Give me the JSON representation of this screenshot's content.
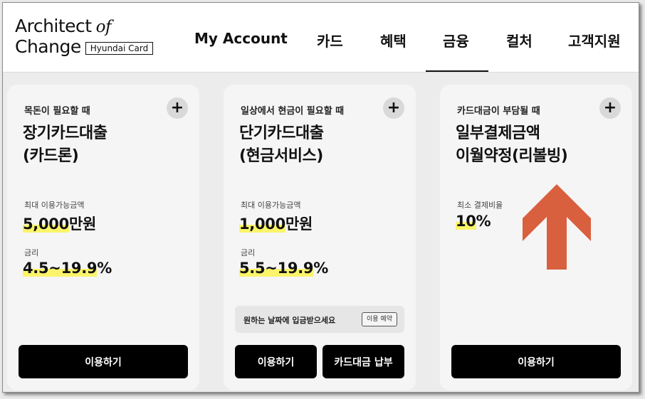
{
  "logo": {
    "line1": "Architect",
    "of": "of",
    "line2": "Change",
    "badge": "Hyundai Card"
  },
  "nav": [
    {
      "label": "My Account"
    },
    {
      "label": "카드"
    },
    {
      "label": "혜택"
    },
    {
      "label": "금융"
    },
    {
      "label": "컬처"
    },
    {
      "label": "고객지원"
    }
  ],
  "cards": [
    {
      "subtitle": "목돈이 필요할 때",
      "title_line1": "장기카드대출",
      "title_line2": "(카드론)",
      "label1": "최대 이용가능금액",
      "value1_num": "5,000",
      "value1_unit": "만원",
      "label2": "금리",
      "value2_num": "4.5~19.9",
      "value2_unit": "%",
      "button": "이용하기"
    },
    {
      "subtitle": "일상에서 현금이 필요할 때",
      "title_line1": "단기카드대출",
      "title_line2": "(현금서비스)",
      "label1": "최대 이용가능금액",
      "value1_num": "1,000",
      "value1_unit": "만원",
      "label2": "금리",
      "value2_num": "5.5~19.9",
      "value2_unit": "%",
      "note": "원하는 날짜에 입금받으세요",
      "note_button": "이용 예약",
      "button": "이용하기",
      "button2": "카드대금 납부"
    },
    {
      "subtitle": "카드대금이 부담될 때",
      "title_line1": "일부결제금액",
      "title_line2": "이월약정(리볼빙)",
      "label1": "최소 결제비율",
      "value1_num": "10",
      "value1_unit": "%",
      "button": "이용하기"
    }
  ],
  "plus_symbol": "+",
  "colors": {
    "highlight": "#fbf46a",
    "arrow": "#d9603f",
    "button": "#000000"
  }
}
